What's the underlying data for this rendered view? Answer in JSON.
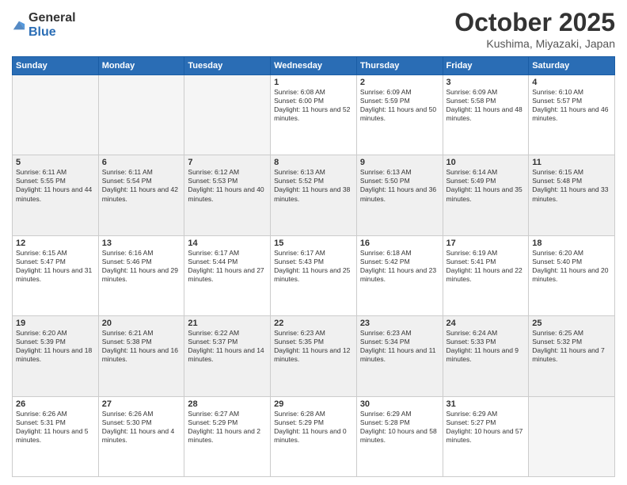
{
  "logo": {
    "general": "General",
    "blue": "Blue"
  },
  "header": {
    "month": "October 2025",
    "location": "Kushima, Miyazaki, Japan"
  },
  "weekdays": [
    "Sunday",
    "Monday",
    "Tuesday",
    "Wednesday",
    "Thursday",
    "Friday",
    "Saturday"
  ],
  "weeks": [
    [
      {
        "day": "",
        "sunrise": "",
        "sunset": "",
        "daylight": ""
      },
      {
        "day": "",
        "sunrise": "",
        "sunset": "",
        "daylight": ""
      },
      {
        "day": "",
        "sunrise": "",
        "sunset": "",
        "daylight": ""
      },
      {
        "day": "1",
        "sunrise": "Sunrise: 6:08 AM",
        "sunset": "Sunset: 6:00 PM",
        "daylight": "Daylight: 11 hours and 52 minutes."
      },
      {
        "day": "2",
        "sunrise": "Sunrise: 6:09 AM",
        "sunset": "Sunset: 5:59 PM",
        "daylight": "Daylight: 11 hours and 50 minutes."
      },
      {
        "day": "3",
        "sunrise": "Sunrise: 6:09 AM",
        "sunset": "Sunset: 5:58 PM",
        "daylight": "Daylight: 11 hours and 48 minutes."
      },
      {
        "day": "4",
        "sunrise": "Sunrise: 6:10 AM",
        "sunset": "Sunset: 5:57 PM",
        "daylight": "Daylight: 11 hours and 46 minutes."
      }
    ],
    [
      {
        "day": "5",
        "sunrise": "Sunrise: 6:11 AM",
        "sunset": "Sunset: 5:55 PM",
        "daylight": "Daylight: 11 hours and 44 minutes."
      },
      {
        "day": "6",
        "sunrise": "Sunrise: 6:11 AM",
        "sunset": "Sunset: 5:54 PM",
        "daylight": "Daylight: 11 hours and 42 minutes."
      },
      {
        "day": "7",
        "sunrise": "Sunrise: 6:12 AM",
        "sunset": "Sunset: 5:53 PM",
        "daylight": "Daylight: 11 hours and 40 minutes."
      },
      {
        "day": "8",
        "sunrise": "Sunrise: 6:13 AM",
        "sunset": "Sunset: 5:52 PM",
        "daylight": "Daylight: 11 hours and 38 minutes."
      },
      {
        "day": "9",
        "sunrise": "Sunrise: 6:13 AM",
        "sunset": "Sunset: 5:50 PM",
        "daylight": "Daylight: 11 hours and 36 minutes."
      },
      {
        "day": "10",
        "sunrise": "Sunrise: 6:14 AM",
        "sunset": "Sunset: 5:49 PM",
        "daylight": "Daylight: 11 hours and 35 minutes."
      },
      {
        "day": "11",
        "sunrise": "Sunrise: 6:15 AM",
        "sunset": "Sunset: 5:48 PM",
        "daylight": "Daylight: 11 hours and 33 minutes."
      }
    ],
    [
      {
        "day": "12",
        "sunrise": "Sunrise: 6:15 AM",
        "sunset": "Sunset: 5:47 PM",
        "daylight": "Daylight: 11 hours and 31 minutes."
      },
      {
        "day": "13",
        "sunrise": "Sunrise: 6:16 AM",
        "sunset": "Sunset: 5:46 PM",
        "daylight": "Daylight: 11 hours and 29 minutes."
      },
      {
        "day": "14",
        "sunrise": "Sunrise: 6:17 AM",
        "sunset": "Sunset: 5:44 PM",
        "daylight": "Daylight: 11 hours and 27 minutes."
      },
      {
        "day": "15",
        "sunrise": "Sunrise: 6:17 AM",
        "sunset": "Sunset: 5:43 PM",
        "daylight": "Daylight: 11 hours and 25 minutes."
      },
      {
        "day": "16",
        "sunrise": "Sunrise: 6:18 AM",
        "sunset": "Sunset: 5:42 PM",
        "daylight": "Daylight: 11 hours and 23 minutes."
      },
      {
        "day": "17",
        "sunrise": "Sunrise: 6:19 AM",
        "sunset": "Sunset: 5:41 PM",
        "daylight": "Daylight: 11 hours and 22 minutes."
      },
      {
        "day": "18",
        "sunrise": "Sunrise: 6:20 AM",
        "sunset": "Sunset: 5:40 PM",
        "daylight": "Daylight: 11 hours and 20 minutes."
      }
    ],
    [
      {
        "day": "19",
        "sunrise": "Sunrise: 6:20 AM",
        "sunset": "Sunset: 5:39 PM",
        "daylight": "Daylight: 11 hours and 18 minutes."
      },
      {
        "day": "20",
        "sunrise": "Sunrise: 6:21 AM",
        "sunset": "Sunset: 5:38 PM",
        "daylight": "Daylight: 11 hours and 16 minutes."
      },
      {
        "day": "21",
        "sunrise": "Sunrise: 6:22 AM",
        "sunset": "Sunset: 5:37 PM",
        "daylight": "Daylight: 11 hours and 14 minutes."
      },
      {
        "day": "22",
        "sunrise": "Sunrise: 6:23 AM",
        "sunset": "Sunset: 5:35 PM",
        "daylight": "Daylight: 11 hours and 12 minutes."
      },
      {
        "day": "23",
        "sunrise": "Sunrise: 6:23 AM",
        "sunset": "Sunset: 5:34 PM",
        "daylight": "Daylight: 11 hours and 11 minutes."
      },
      {
        "day": "24",
        "sunrise": "Sunrise: 6:24 AM",
        "sunset": "Sunset: 5:33 PM",
        "daylight": "Daylight: 11 hours and 9 minutes."
      },
      {
        "day": "25",
        "sunrise": "Sunrise: 6:25 AM",
        "sunset": "Sunset: 5:32 PM",
        "daylight": "Daylight: 11 hours and 7 minutes."
      }
    ],
    [
      {
        "day": "26",
        "sunrise": "Sunrise: 6:26 AM",
        "sunset": "Sunset: 5:31 PM",
        "daylight": "Daylight: 11 hours and 5 minutes."
      },
      {
        "day": "27",
        "sunrise": "Sunrise: 6:26 AM",
        "sunset": "Sunset: 5:30 PM",
        "daylight": "Daylight: 11 hours and 4 minutes."
      },
      {
        "day": "28",
        "sunrise": "Sunrise: 6:27 AM",
        "sunset": "Sunset: 5:29 PM",
        "daylight": "Daylight: 11 hours and 2 minutes."
      },
      {
        "day": "29",
        "sunrise": "Sunrise: 6:28 AM",
        "sunset": "Sunset: 5:29 PM",
        "daylight": "Daylight: 11 hours and 0 minutes."
      },
      {
        "day": "30",
        "sunrise": "Sunrise: 6:29 AM",
        "sunset": "Sunset: 5:28 PM",
        "daylight": "Daylight: 10 hours and 58 minutes."
      },
      {
        "day": "31",
        "sunrise": "Sunrise: 6:29 AM",
        "sunset": "Sunset: 5:27 PM",
        "daylight": "Daylight: 10 hours and 57 minutes."
      },
      {
        "day": "",
        "sunrise": "",
        "sunset": "",
        "daylight": ""
      }
    ]
  ]
}
